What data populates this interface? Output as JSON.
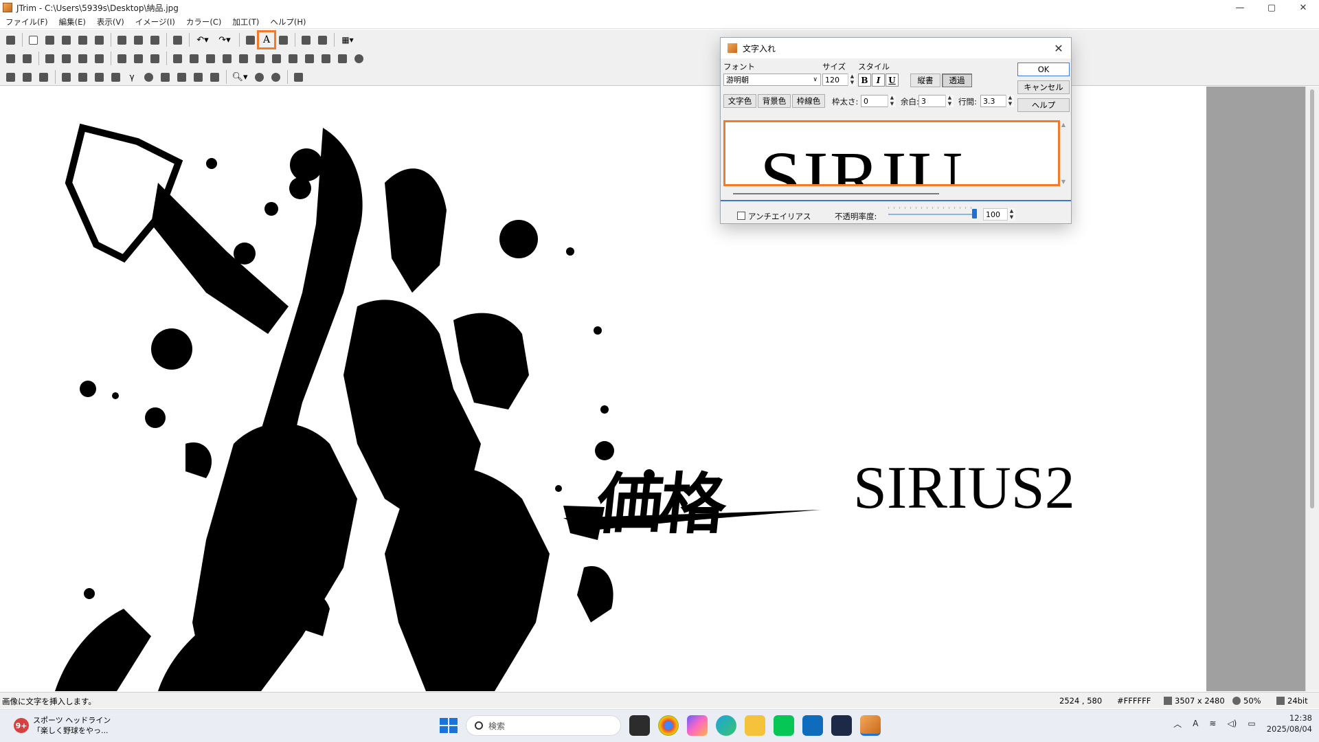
{
  "window": {
    "title": "JTrim - C:\\Users\\5939s\\Desktop\\納品.jpg",
    "controls": {
      "minimize": "—",
      "maximize": "▢",
      "close": "✕"
    }
  },
  "menu": [
    "ファイル(F)",
    "編集(E)",
    "表示(V)",
    "イメージ(I)",
    "カラー(C)",
    "加工(T)",
    "ヘルプ(H)"
  ],
  "toolbar": {
    "highlighted_tool": "A",
    "highlight_color": "#f07c28"
  },
  "canvas": {
    "kanji_text": "価格",
    "inserted_text": "SIRIUS2"
  },
  "dialog": {
    "title": "文字入れ",
    "font_label": "フォント",
    "font_value": "游明朝",
    "size_label": "サイズ",
    "size_value": "120",
    "style_label": "スタイル",
    "bold": "B",
    "italic": "I",
    "underline": "U",
    "vertical_label": "縦書",
    "transparent_label": "透過",
    "text_color_label": "文字色",
    "bg_color_label": "背景色",
    "border_color_label": "枠線色",
    "border_width_label": "枠太さ:",
    "border_width_value": "0",
    "margin_label": "余白:",
    "margin_value": "3",
    "line_spacing_label": "行間:",
    "line_spacing_value": "3.3",
    "ok_label": "OK",
    "cancel_label": "キャンセル",
    "help_label": "ヘルプ",
    "preview_text": "SIRIU",
    "antialias_label": "アンチエイリアス",
    "antialias_checked": false,
    "opacity_label": "不透明率度:",
    "opacity_value": "100"
  },
  "status": {
    "message": "画像に文字を挿入します。",
    "coords": "2524 , 580",
    "color": "#FFFFFF",
    "dimensions": "3507 x 2480",
    "zoom": "50%",
    "bits": "24bit"
  },
  "taskbar": {
    "news_badge": "9+",
    "news_title": "スポーツ ヘッドライン",
    "news_sub": "「楽しく野球をやっ...",
    "search_placeholder": "検索",
    "clock_time": "12:38",
    "clock_date": "2025/08/04",
    "ime": "A"
  }
}
